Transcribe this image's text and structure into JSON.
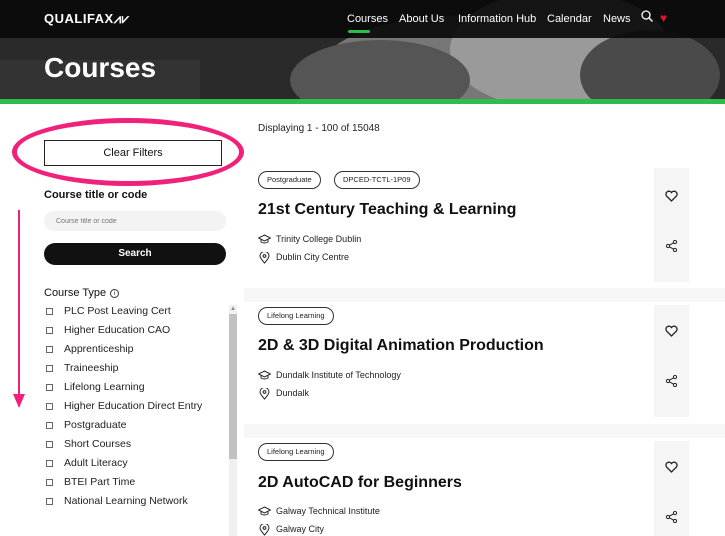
{
  "header": {
    "logo": "QUALIFAX",
    "nav": [
      "Courses",
      "About Us",
      "Information Hub",
      "Calendar",
      "News"
    ],
    "active_nav": "Courses",
    "page_title": "Courses"
  },
  "sidebar": {
    "clear_filters": "Clear Filters",
    "title_label": "Course title or code",
    "search_placeholder": "Course title or code",
    "search_button": "Search",
    "course_type_label": "Course Type",
    "course_types": [
      "PLC Post Leaving Cert",
      "Higher Education CAO",
      "Apprenticeship",
      "Traineeship",
      "Lifelong Learning",
      "Higher Education Direct Entry",
      "Postgraduate",
      "Short Courses",
      "Adult Literacy",
      "BTEI Part Time",
      "National Learning Network"
    ]
  },
  "results": {
    "displaying": "Displaying 1 - 100 of 15048",
    "courses": [
      {
        "tags": [
          "Postgraduate",
          "DPCED-TCTL-1P09"
        ],
        "title": "21st Century Teaching & Learning",
        "institution": "Trinity College Dublin",
        "location": "Dublin City Centre"
      },
      {
        "tags": [
          "Lifelong Learning"
        ],
        "title": "2D & 3D Digital Animation Production",
        "institution": "Dundalk Institute of Technology",
        "location": "Dundalk"
      },
      {
        "tags": [
          "Lifelong Learning"
        ],
        "title": "2D AutoCAD for Beginners",
        "institution": "Galway Technical Institute",
        "location": "Galway City"
      }
    ]
  },
  "icons": {
    "favorite": "heart-outline-icon",
    "share": "share-icon",
    "institution": "graduation-cap-icon",
    "location": "location-pin-icon"
  },
  "colors": {
    "accent_green": "#2ebd4a",
    "annotation_pink": "#f0217a",
    "heart_red": "#e0152a"
  }
}
